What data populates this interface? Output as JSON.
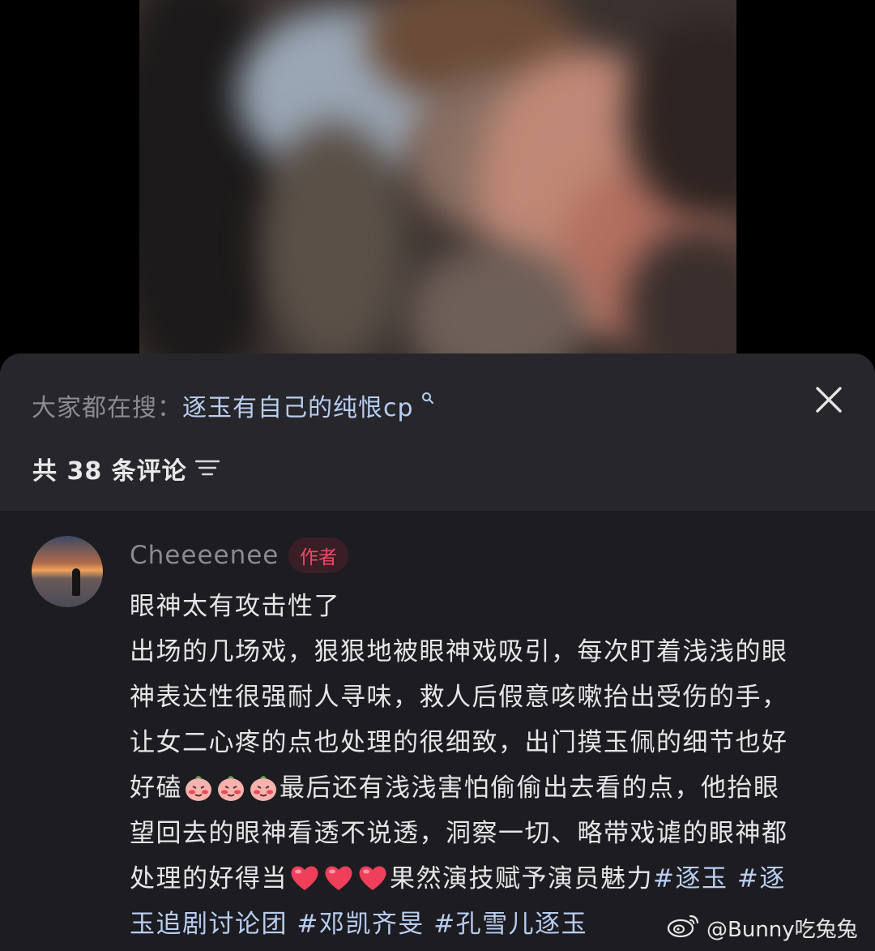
{
  "search_bar": {
    "prefix": "大家都在搜：",
    "query": "逐玉有自己的纯恨cp"
  },
  "comments_header": {
    "count_text": "共 38 条评论"
  },
  "comment": {
    "username": "Cheeeenee",
    "badge": "作者",
    "lines": [
      "眼神太有攻击性了",
      "出场的几场戏，狠狠地被眼神戏吸引，每次盯着浅浅的眼",
      "神表达性很强耐人寻味，救人后假意咳嗽抬出受伤的手，",
      "让女二心疼的点也处理的很细致，出门摸玉佩的细节也好"
    ],
    "line5_start": "好磕",
    "line5_end": "最后还有浅浅害怕偷偷出去看的点，他抬眼",
    "line6": "望回去的眼神看透不说透，洞察一切、略带戏谑的眼神都",
    "line7_start": "处理的好得当",
    "line7_mid": "果然演技赋予演员魅力",
    "tag1": "#逐玉",
    "tag2_part1": "#逐",
    "tag2_part2": "玉追剧讨论团",
    "tag3": "#邓凯齐旻",
    "tag4": "#孔雪儿逐玉"
  },
  "watermark": {
    "text": "@Bunny吃兔兔"
  },
  "icons": {
    "close": "close-icon",
    "sort": "sort-icon",
    "search": "search-icon",
    "weibo": "weibo-logo-icon"
  },
  "colors": {
    "link": "#b9cdf0",
    "badge_text": "#f04a68",
    "sheet_bg": "#1c1c21"
  }
}
